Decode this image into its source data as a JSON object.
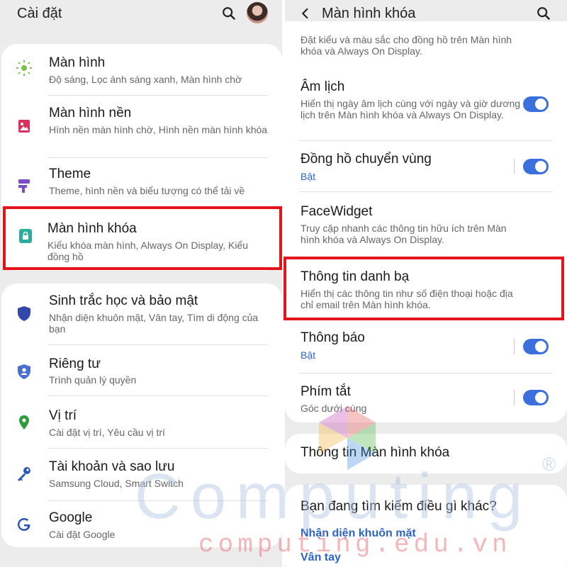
{
  "left": {
    "title": "Cài đặt",
    "items": [
      {
        "icon": "brightness-icon",
        "title": "Màn hình",
        "subtitle": "Độ sáng, Lọc ánh sáng xanh, Màn hình chờ"
      },
      {
        "icon": "wallpaper-icon",
        "title": "Màn hình nền",
        "subtitle": "Hình nền màn hình chờ, Hình nền màn hình khóa"
      },
      {
        "icon": "theme-icon",
        "title": "Theme",
        "subtitle": "Theme, hình nền và biểu tượng có thể tải về"
      },
      {
        "icon": "lock-screen-icon",
        "title": "Màn hình khóa",
        "subtitle": "Kiểu khóa màn hình, Always On Display, Kiểu đồng hồ"
      },
      {
        "icon": "shield-icon",
        "title": "Sinh trắc học và bảo mật",
        "subtitle": "Nhận diện khuôn mặt, Vân tay, Tìm di động của bạn"
      },
      {
        "icon": "privacy-icon",
        "title": "Riêng tư",
        "subtitle": "Trình quản lý quyền"
      },
      {
        "icon": "location-icon",
        "title": "Vị trí",
        "subtitle": "Cài đặt vị trí, Yêu cầu vị trí"
      },
      {
        "icon": "key-icon",
        "title": "Tài khoản và sao lưu",
        "subtitle": "Samsung Cloud, Smart Switch"
      },
      {
        "icon": "google-icon",
        "title": "Google",
        "subtitle": "Cài đặt Google"
      }
    ]
  },
  "right": {
    "title": "Màn hình khóa",
    "top_cut_text": "Đặt kiểu và màu sắc cho đồng hồ trên Màn hình khóa và Always On Display.",
    "items": [
      {
        "title": "Âm lịch",
        "subtitle": "Hiển thị ngày âm lịch cùng với ngày và giờ dương lịch trên Màn hình khóa và Always On Display.",
        "toggle": true
      },
      {
        "title": "Đồng hồ chuyển vùng",
        "subtitle": "Bật",
        "toggle": true
      },
      {
        "title": "FaceWidget",
        "subtitle": "Truy cập nhanh các thông tin hữu ích trên Màn hình khóa và Always On Display."
      },
      {
        "title": "Thông tin danh bạ",
        "subtitle": "Hiển thị các thông tin như số điện thoại hoặc địa chỉ email trên Màn hình khóa."
      },
      {
        "title": "Thông báo",
        "subtitle": "Bật",
        "toggle": true
      },
      {
        "title": "Phím tắt",
        "subtitle": "Góc dưới cùng",
        "toggle": true
      }
    ],
    "about": "Thông tin Màn hình khóa",
    "suggest_title": "Bạn đang tìm kiếm điều gì khác?",
    "suggest_links": [
      "Nhận diện khuôn mặt",
      "Vân tay"
    ]
  },
  "watermark": {
    "brand": "Computing",
    "site": "computing.edu.vn",
    "reg": "®"
  },
  "colors": {
    "accent": "#3b6fdd",
    "link": "#2c64c9",
    "highlight": "#e3141a"
  }
}
